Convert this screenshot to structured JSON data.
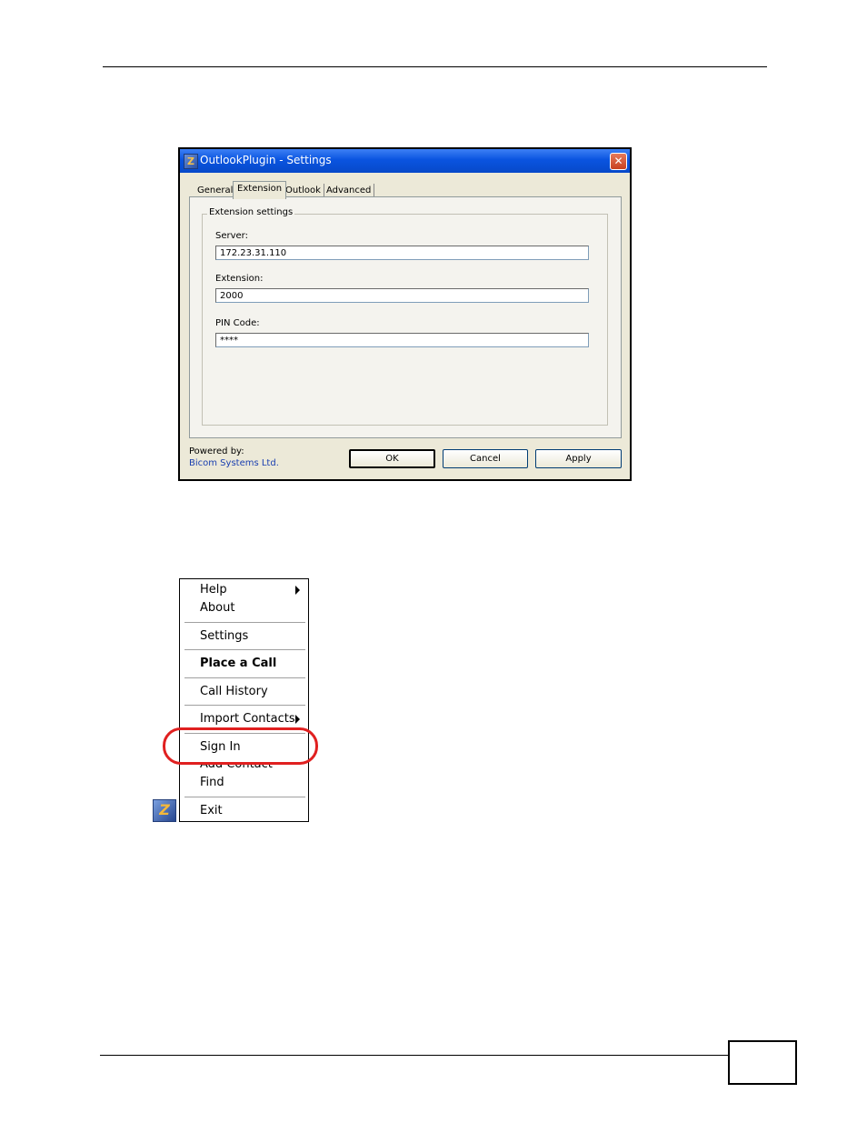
{
  "dialog": {
    "title": "OutlookPlugin - Settings",
    "close_symbol": "✕",
    "app_icon": "Z",
    "tabs": [
      {
        "label": "General"
      },
      {
        "label": "Extension"
      },
      {
        "label": "Outlook"
      },
      {
        "label": "Advanced"
      }
    ],
    "active_tab": "Extension",
    "group_title": "Extension settings",
    "server_label": "Server:",
    "server_value": "172.23.31.110",
    "extension_label": "Extension:",
    "extension_value": "2000",
    "pin_label": "PIN Code:",
    "pin_value": "****",
    "powered_by_label": "Powered by:",
    "powered_by_link": "Bicom Systems Ltd.",
    "ok_label": "OK",
    "cancel_label": "Cancel",
    "apply_label": "Apply"
  },
  "menu": {
    "items": [
      {
        "label": "Help"
      },
      {
        "label": "About"
      },
      {
        "label": "Settings"
      },
      {
        "label": "Place a Call"
      },
      {
        "label": "Call History"
      },
      {
        "label": "Import Contacts"
      },
      {
        "label": "Sign In"
      },
      {
        "label": "Add Contact"
      },
      {
        "label": "Find"
      },
      {
        "label": "Exit"
      }
    ],
    "highlighted_item": "Sign In"
  },
  "tray": {
    "icon": "Z"
  },
  "colors": {
    "highlight": "#e02020",
    "titlebar": "#0a54e0"
  }
}
